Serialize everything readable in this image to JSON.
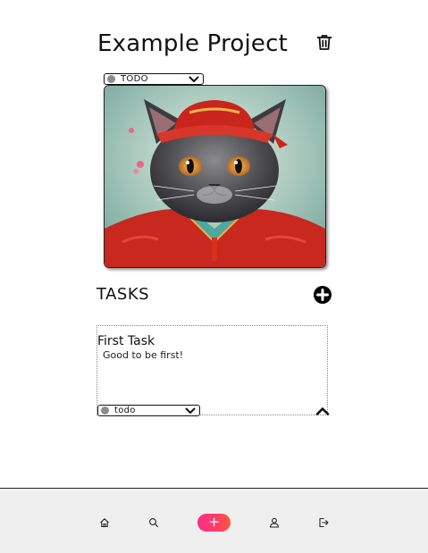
{
  "project": {
    "title": "Example Project",
    "status": "TODO"
  },
  "tasks": {
    "heading": "TASKS",
    "items": [
      {
        "title": "First Task",
        "description": "Good to be first!",
        "status": "todo"
      }
    ]
  },
  "bottom_nav": {
    "add_label": "+",
    "icons": [
      "home-icon",
      "search-icon",
      "add-icon",
      "user-icon",
      "logout-icon"
    ],
    "accent_colors": [
      "#ff2d8a",
      "#ff5a3c"
    ]
  },
  "colors": {
    "status_dot": "#8c8c8c",
    "nav_background": "#efefef"
  }
}
